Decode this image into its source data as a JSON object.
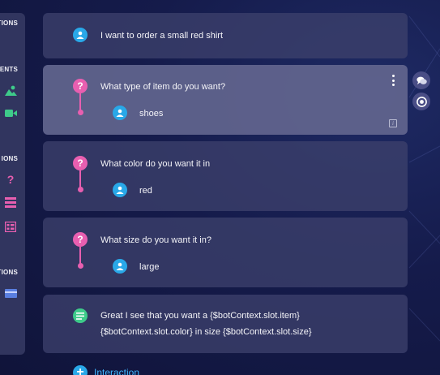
{
  "sidebar": {
    "sections": [
      {
        "label": "TIONS"
      },
      {
        "label": "ENTS"
      },
      {
        "label": "IONS"
      },
      {
        "label": "TIONS"
      }
    ],
    "icons": [
      "image-icon",
      "video-icon",
      "question-icon",
      "list-icon",
      "form-icon",
      "card-icon"
    ]
  },
  "messages": [
    {
      "type": "user",
      "text": "I want to order a small red shirt"
    },
    {
      "type": "question",
      "text": "What type of item do you want?",
      "answer": "shoes",
      "active": true
    },
    {
      "type": "question",
      "text": "What color do you want it in",
      "answer": "red"
    },
    {
      "type": "question",
      "text": "What size do you want it in?",
      "answer": "large"
    },
    {
      "type": "bot",
      "lines": [
        "Great I see that you want a {$botContext.slot.item}",
        "{$botContext.slot.color} in size {$botContext.slot.size}"
      ]
    }
  ],
  "add_interaction_label": "Interaction",
  "colors": {
    "question_accent": "#e85fb0",
    "user_avatar": "#29a8e8",
    "bot_icon": "#3ecb8a",
    "link": "#3fb6ff"
  }
}
